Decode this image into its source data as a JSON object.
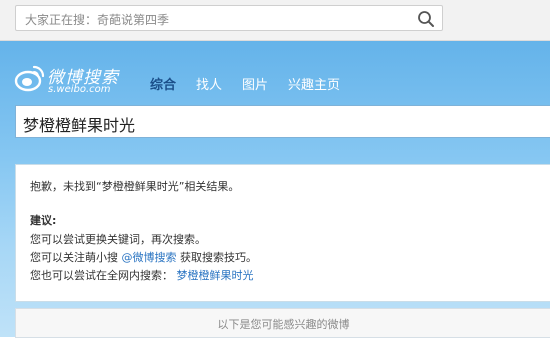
{
  "top_search": {
    "prompt": "大家正在搜：奇葩说第四季",
    "icon": "search-icon"
  },
  "logo": {
    "main": "微博搜索",
    "sub": "s.weibo.com",
    "icon": "weibo-eye-logo"
  },
  "nav": {
    "items": [
      {
        "label": "综合",
        "active": true
      },
      {
        "label": "找人",
        "active": false
      },
      {
        "label": "图片",
        "active": false
      },
      {
        "label": "兴趣主页",
        "active": false
      }
    ]
  },
  "query": {
    "value": "梦橙橙鲜果时光"
  },
  "result": {
    "sorry_prefix": "抱歉，未找到“",
    "sorry_query": "梦橙橙鲜果时光",
    "sorry_suffix": "”相关结果。",
    "advice_title": "建议:",
    "advice_1": "您可以尝试更换关键词，再次搜索。",
    "advice_2_prefix": "您可以关注萌小搜",
    "advice_2_link": "@微博搜索",
    "advice_2_suffix": "获取搜索技巧。",
    "advice_3_prefix": "您也可以尝试在全网内搜索：",
    "advice_3_link": "梦橙橙鲜果时光"
  },
  "suggest": {
    "text": "以下是您可能感兴趣的微博"
  },
  "colors": {
    "accent_link": "#2a74c2",
    "nav_active": "#1b4f8a",
    "hero_top": "#64b3ea",
    "hero_bottom": "#bfe2f8"
  }
}
